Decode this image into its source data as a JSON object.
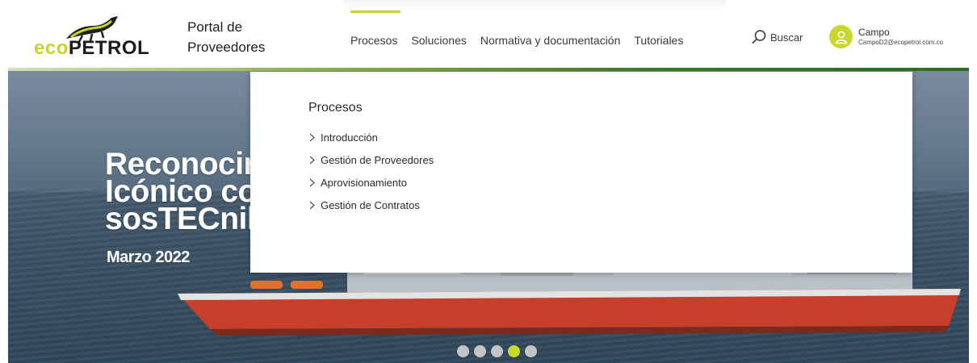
{
  "brand": {
    "logo_prefix": "eco",
    "logo_suffix": "PETROL",
    "portal_title_line1": "Portal de",
    "portal_title_line2": "Proveedores",
    "accent_color": "#c7d42a"
  },
  "nav": {
    "items": [
      {
        "label": "Procesos",
        "active": true
      },
      {
        "label": "Soluciones",
        "active": false
      },
      {
        "label": "Normativa y documentación",
        "active": false
      },
      {
        "label": "Tutoriales",
        "active": false
      }
    ],
    "search_label": "Buscar"
  },
  "user": {
    "name": "Campo",
    "email": "CampoD2@ecopetrol.com.co"
  },
  "megamenu": {
    "title": "Procesos",
    "items": [
      {
        "label": "Introducción"
      },
      {
        "label": "Gestión de Proveedores"
      },
      {
        "label": "Aprovisionamiento"
      },
      {
        "label": "Gestión de Contratos"
      }
    ]
  },
  "hero": {
    "title_line1": "Reconocimiento",
    "title_line2": "Icónico con",
    "title_line3": "sosTECnible",
    "date": "Marzo 2022",
    "slides": 5,
    "active_slide": 4
  }
}
